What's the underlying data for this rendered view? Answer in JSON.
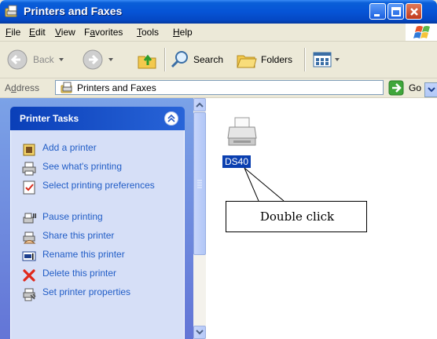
{
  "window": {
    "title": "Printers and Faxes"
  },
  "menubar": {
    "items": [
      {
        "label": "File",
        "u": "F",
        "rest": "ile"
      },
      {
        "label": "Edit",
        "u": "E",
        "rest": "dit"
      },
      {
        "label": "View",
        "u": "V",
        "rest": "iew"
      },
      {
        "label": "Favorites",
        "pre": "F",
        "u": "a",
        "rest": "vorites"
      },
      {
        "label": "Tools",
        "u": "T",
        "rest": "ools"
      },
      {
        "label": "Help",
        "u": "H",
        "rest": "elp"
      }
    ]
  },
  "toolbar": {
    "back_label": "Back",
    "search_label": "Search",
    "folders_label": "Folders"
  },
  "address": {
    "label_u": "d",
    "label_pre": "A",
    "label_rest": "dress",
    "value": "Printers and Faxes",
    "go_label": "Go"
  },
  "tasks": {
    "title": "Printer Tasks",
    "items": [
      {
        "label": "Add a printer",
        "icon": "add-printer-icon"
      },
      {
        "label": "See what's printing",
        "icon": "print-queue-icon"
      },
      {
        "label": "Select printing preferences",
        "icon": "preferences-icon"
      },
      {
        "label": "Pause printing",
        "icon": "pause-printer-icon"
      },
      {
        "label": "Share this printer",
        "icon": "share-printer-icon"
      },
      {
        "label": "Rename this printer",
        "icon": "rename-icon"
      },
      {
        "label": "Delete this printer",
        "icon": "delete-icon"
      },
      {
        "label": "Set printer properties",
        "icon": "properties-icon"
      }
    ]
  },
  "content": {
    "printer_name": "DS40",
    "callout_text": "Double click"
  },
  "colors": {
    "title_blue": "#0654d6",
    "task_link": "#215dc6",
    "delete_red": "#e0281b",
    "selection": "#0a3fb0"
  }
}
